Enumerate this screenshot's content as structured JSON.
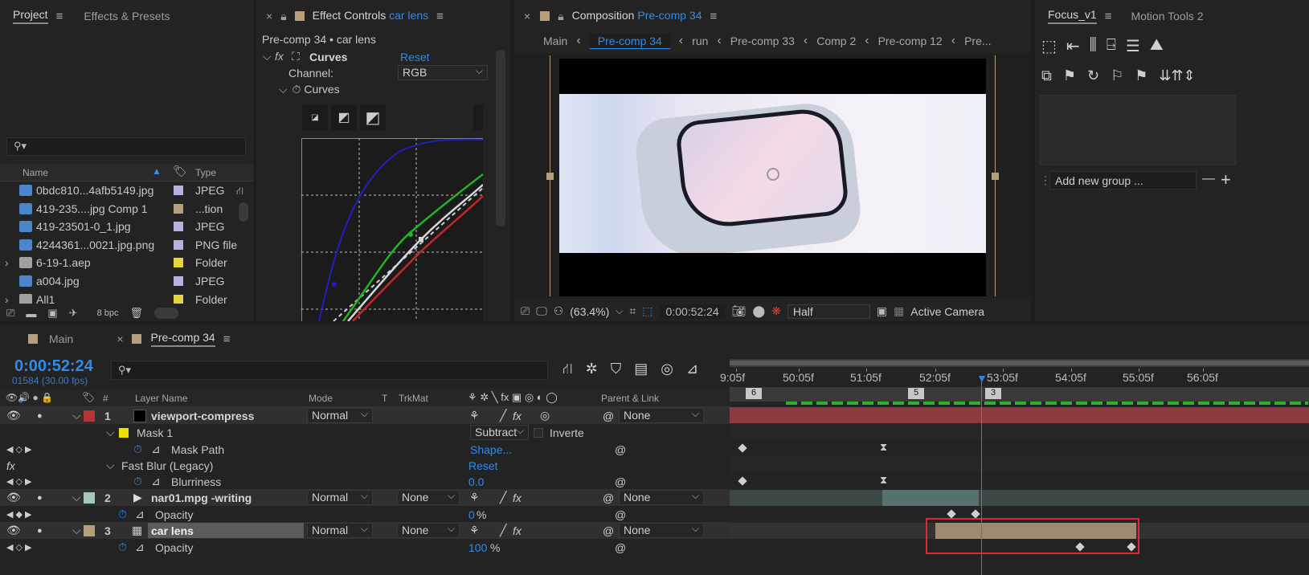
{
  "project": {
    "tabs": [
      "Project",
      "Effects & Presets"
    ],
    "search_placeholder": "",
    "columns": [
      "Name",
      "Type"
    ],
    "items": [
      {
        "name": "0bdc810...4afb5149.jpg",
        "type": "JPEG",
        "color": "#b5b2e0",
        "icon": "image-icon"
      },
      {
        "name": "419-235....jpg Comp 1",
        "type": "...tion",
        "color": "#b59f7a",
        "icon": "composition-icon"
      },
      {
        "name": "419-23501-0_1.jpg",
        "type": "JPEG",
        "color": "#b5b2e0",
        "icon": "image-icon"
      },
      {
        "name": "4244361...0021.jpg.png",
        "type": "PNG file",
        "color": "#b5b2e0",
        "icon": "image-icon"
      },
      {
        "name": "6-19-1.aep",
        "type": "Folder",
        "color": "#e6d438",
        "icon": "folder-icon"
      },
      {
        "name": "a004.jpg",
        "type": "JPEG",
        "color": "#b5b2e0",
        "icon": "image-icon"
      },
      {
        "name": "All1",
        "type": "Folder",
        "color": "#e6d438",
        "icon": "folder-icon"
      }
    ],
    "bpc": "8 bpc"
  },
  "effect_controls": {
    "tab_prefix": "Effect Controls",
    "tab_layer": "car lens",
    "subtitle": "Pre-comp 34 • car lens",
    "effect_name": "Curves",
    "reset": "Reset",
    "channel_label": "Channel:",
    "channel_value": "RGB",
    "curves_label": "Curves"
  },
  "composition": {
    "tab_prefix": "Composition",
    "tab_comp": "Pre-comp 34",
    "breadcrumbs": [
      "Main",
      "Pre-comp 34",
      "run",
      "Pre-comp 33",
      "Comp 2",
      "Pre-comp 12",
      "Pre..."
    ],
    "zoom": "(63.4%)",
    "timecode": "0:00:52:24",
    "resolution": "Half",
    "camera": "Active Camera"
  },
  "focus": {
    "tabs": [
      "Focus_v1",
      "Motion Tools 2"
    ],
    "add_group_placeholder": "Add new group ...",
    "minus": "—",
    "plus": "+"
  },
  "timeline": {
    "tabs": [
      "Main",
      "Pre-comp 34"
    ],
    "timecode": "0:00:52:24",
    "frames": "01584 (30.00 fps)",
    "ruler_labels": [
      "9:05f",
      "50:05f",
      "51:05f",
      "52:05f",
      "53:05f",
      "54:05f",
      "55:05f",
      "56:05f"
    ],
    "markers": [
      "6",
      "5",
      "3"
    ],
    "columns": {
      "hash": "#",
      "layer_name": "Layer Name",
      "mode": "Mode",
      "t": "T",
      "trkmat": "TrkMat",
      "parent": "Parent & Link"
    },
    "layers": [
      {
        "num": "1",
        "name": "viewport-compress",
        "mode": "Normal",
        "trkmat": "",
        "parent": "None",
        "label_color": "#b53535",
        "swatch": "#000000"
      },
      {
        "num": "2",
        "name": "nar01.mpg -writing",
        "mode": "Normal",
        "trkmat": "None",
        "parent": "None",
        "label_color": "#a4c8c0",
        "swatch": ""
      },
      {
        "num": "3",
        "name": "car lens",
        "mode": "Normal",
        "trkmat": "None",
        "parent": "None",
        "label_color": "#b59f7a",
        "swatch": ""
      }
    ],
    "mask": {
      "name": "Mask 1",
      "mode": "Subtract",
      "invert": "Inverte",
      "path_label": "Mask Path",
      "path_value": "Shape..."
    },
    "blur": {
      "name": "Fast Blur (Legacy)",
      "reset": "Reset",
      "prop": "Blurriness",
      "value": "0.0"
    },
    "opacity2": {
      "label": "Opacity",
      "value": "0",
      "unit": "%"
    },
    "opacity3": {
      "label": "Opacity",
      "value": "100",
      "unit": "%"
    }
  },
  "colors": {
    "accent": "#2d8ceb",
    "playhead": "#3a7fd9",
    "highlight_box": "#e0262e",
    "layer1_bar": "#8c3b40",
    "layer2_bar": "#55706e",
    "layer3_bar": "#9c8b6e"
  }
}
